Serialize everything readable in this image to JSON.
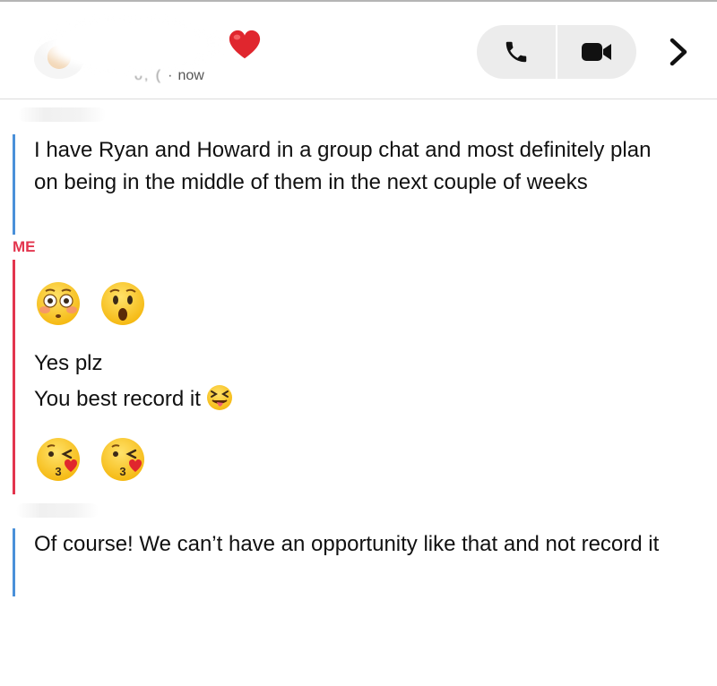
{
  "header": {
    "status_time": "now",
    "status_prefix": "ᴗ, (",
    "status_dot": "·",
    "icons": [
      "heart-emoji",
      "phone-icon",
      "video-camera-icon",
      "chevron-right-icon"
    ]
  },
  "messages": {
    "friend_1": {
      "text": "I have Ryan and Howard in a group chat and most definitely plan on being in the middle of them in the next couple of weeks"
    },
    "me": {
      "label": "ME",
      "emojis_1": [
        "flushed-face",
        "hushed-face"
      ],
      "line_1": "Yes plz",
      "line_2": "You best record it",
      "line_2_emoji": "squinting-tongue-face",
      "emojis_2": [
        "kissing-heart-face",
        "kissing-heart-face"
      ]
    },
    "friend_2": {
      "text": "Of course! We can’t have an opportunity like that and not record it"
    }
  },
  "colors": {
    "friend_bar": "#4a90d9",
    "me_bar": "#e3354e",
    "me_label": "#e3354e",
    "call_group_bg": "#ececec"
  }
}
